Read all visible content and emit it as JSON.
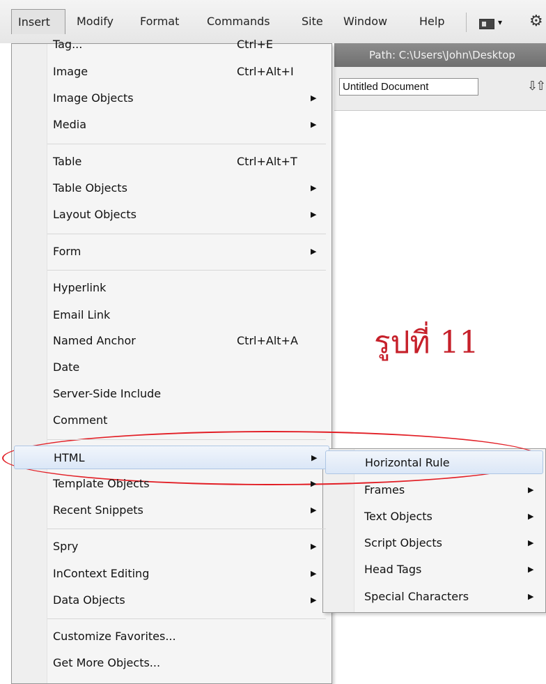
{
  "menubar": {
    "items": [
      "Insert",
      "Modify",
      "Format",
      "Commands",
      "Site",
      "Window",
      "Help"
    ],
    "active": "Insert"
  },
  "editor": {
    "path_label": "Path:  C:\\Users\\John\\Desktop",
    "title_value": "Untitled Document",
    "caption": "รูปที่ 11"
  },
  "insert_menu": {
    "items": [
      {
        "label": "Tag...",
        "shortcut": "Ctrl+E",
        "submenu": false
      },
      {
        "label": "Image",
        "shortcut": "Ctrl+Alt+I",
        "submenu": false
      },
      {
        "label": "Image Objects",
        "shortcut": "",
        "submenu": true
      },
      {
        "label": "Media",
        "shortcut": "",
        "submenu": true
      },
      {
        "label": "Table",
        "shortcut": "Ctrl+Alt+T",
        "submenu": false
      },
      {
        "label": "Table Objects",
        "shortcut": "",
        "submenu": true
      },
      {
        "label": "Layout Objects",
        "shortcut": "",
        "submenu": true
      },
      {
        "label": "Form",
        "shortcut": "",
        "submenu": true
      },
      {
        "label": "Hyperlink",
        "shortcut": "",
        "submenu": false
      },
      {
        "label": "Email Link",
        "shortcut": "",
        "submenu": false
      },
      {
        "label": "Named Anchor",
        "shortcut": "Ctrl+Alt+A",
        "submenu": false
      },
      {
        "label": "Date",
        "shortcut": "",
        "submenu": false
      },
      {
        "label": "Server-Side Include",
        "shortcut": "",
        "submenu": false
      },
      {
        "label": "Comment",
        "shortcut": "",
        "submenu": false
      },
      {
        "label": "HTML",
        "shortcut": "",
        "submenu": true
      },
      {
        "label": "Template Objects",
        "shortcut": "",
        "submenu": true
      },
      {
        "label": "Recent Snippets",
        "shortcut": "",
        "submenu": true
      },
      {
        "label": "Spry",
        "shortcut": "",
        "submenu": true
      },
      {
        "label": "InContext Editing",
        "shortcut": "",
        "submenu": true
      },
      {
        "label": "Data Objects",
        "shortcut": "",
        "submenu": true
      },
      {
        "label": "Customize Favorites...",
        "shortcut": "",
        "submenu": false
      },
      {
        "label": "Get More Objects...",
        "shortcut": "",
        "submenu": false
      }
    ],
    "highlighted": "HTML"
  },
  "html_submenu": {
    "items": [
      {
        "label": "Horizontal Rule",
        "submenu": false
      },
      {
        "label": "Frames",
        "submenu": true
      },
      {
        "label": "Text Objects",
        "submenu": true
      },
      {
        "label": "Script Objects",
        "submenu": true
      },
      {
        "label": "Head Tags",
        "submenu": true
      },
      {
        "label": "Special Characters",
        "submenu": true
      }
    ],
    "highlighted": "Horizontal Rule"
  },
  "glyphs": {
    "submenu_arrow": "▶",
    "caret": "▾",
    "gear": "⚙",
    "sort": "⇩⇧"
  },
  "colors": {
    "annotation": "#e21f26",
    "caption": "#c6202a",
    "highlight_border": "#aec6e4"
  }
}
